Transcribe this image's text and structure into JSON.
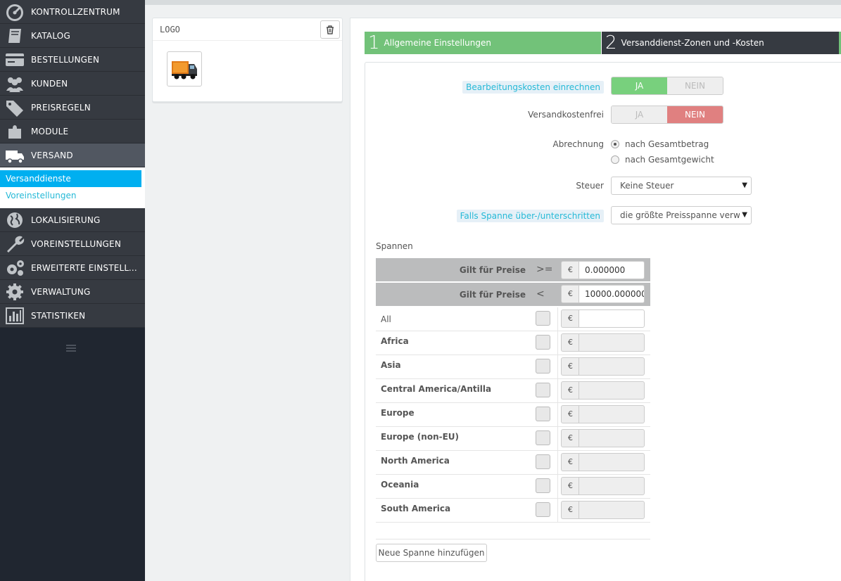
{
  "sidebar": {
    "items": [
      {
        "label": "KONTROLLZENTRUM",
        "icon": "dashboard-icon"
      },
      {
        "label": "KATALOG",
        "icon": "book-icon"
      },
      {
        "label": "BESTELLUNGEN",
        "icon": "credit-card-icon"
      },
      {
        "label": "KUNDEN",
        "icon": "users-icon"
      },
      {
        "label": "PREISREGELN",
        "icon": "tags-icon"
      },
      {
        "label": "MODULE",
        "icon": "puzzle-icon"
      },
      {
        "label": "VERSAND",
        "icon": "truck-icon"
      },
      {
        "label": "LOKALISIERUNG",
        "icon": "globe-icon"
      },
      {
        "label": "VOREINSTELLUNGEN",
        "icon": "wrench-icon"
      },
      {
        "label": "ERWEITERTE EINSTELLUN...",
        "icon": "cogs-icon"
      },
      {
        "label": "VERWALTUNG",
        "icon": "gear-icon"
      },
      {
        "label": "STATISTIKEN",
        "icon": "bar-chart-icon"
      }
    ],
    "submenu": [
      {
        "label": "Versanddienste"
      },
      {
        "label": "Voreinstellungen"
      }
    ]
  },
  "logo_panel": {
    "title": "LOGO"
  },
  "wizard": {
    "step1": {
      "num": "1",
      "label": "Allgemeine Einstellungen"
    },
    "step2": {
      "num": "2",
      "label": "Versanddienst-Zonen und -Kosten"
    }
  },
  "form": {
    "handling_label": "Bearbeitungskosten einrechnen",
    "free_label": "Versandkostenfrei",
    "yes": "JA",
    "no": "NEIN",
    "billing_label": "Abrechnung",
    "billing_option1": "nach Gesamtbetrag",
    "billing_option2": "nach Gesamtgewicht",
    "tax_label": "Steuer",
    "tax_value": "Keine Steuer",
    "out_of_range_label": "Falls Spanne über-/unterschritten",
    "out_of_range_value": "die größte Preisspanne verw"
  },
  "ranges": {
    "title": "Spannen",
    "row_label": "Gilt für Preise",
    "op_ge": ">=",
    "op_lt": "<",
    "currency": "€",
    "from_value": "0.000000",
    "to_value": "10000.000000",
    "zones": [
      {
        "name": "All"
      },
      {
        "name": "Africa"
      },
      {
        "name": "Asia"
      },
      {
        "name": "Central America/Antilla"
      },
      {
        "name": "Europe"
      },
      {
        "name": "Europe (non-EU)"
      },
      {
        "name": "North America"
      },
      {
        "name": "Oceania"
      },
      {
        "name": "South America"
      }
    ],
    "add_button": "Neue Spanne hinzufügen"
  },
  "colors": {
    "sidebar_bg": "#363a41",
    "active_green": "#72c279",
    "active_red": "#e08080",
    "link_blue": "#25b9d7",
    "submenu_active": "#00aff0"
  }
}
